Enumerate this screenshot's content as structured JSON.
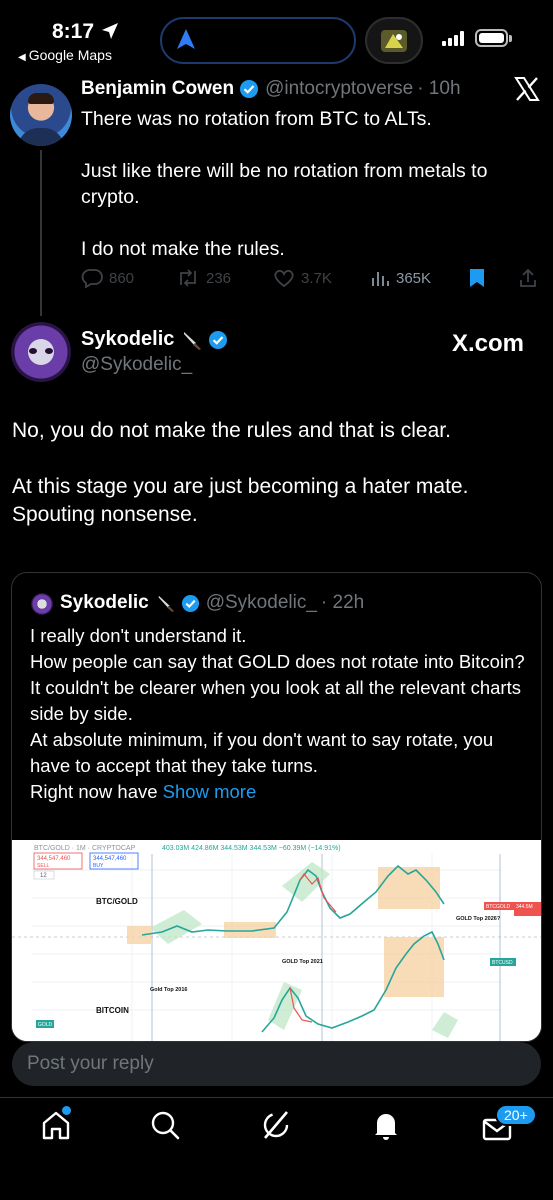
{
  "status_bar": {
    "time": "8:17",
    "back_app": "Google Maps"
  },
  "tweet1": {
    "author_name": "Benjamin Cowen",
    "handle": "@intocryptoverse",
    "time_ago": "· 10h",
    "paragraphs": [
      "There was no rotation from BTC to ALTs.",
      "Just like there will be no rotation from metals to crypto.",
      "I do not make the rules."
    ],
    "replies": "860",
    "reposts": "236",
    "likes": "3.7K",
    "views": "365K"
  },
  "tweet2": {
    "author_name": "Sykodelic",
    "handle": "@Sykodelic_",
    "brand": "X.com",
    "paragraphs": [
      "No, you do not make the rules and that is clear.",
      "At this stage you are just becoming a hater mate. Spouting nonsense."
    ]
  },
  "quote": {
    "author_name": "Sykodelic",
    "handle": "@Sykodelic_",
    "time_ago": "· 22h",
    "lines": [
      "I really don't understand it.",
      "How people can say that GOLD does not rotate into Bitcoin?",
      "It couldn't be clearer when you look at all the relevant charts side by side.",
      "At absolute minimum, if you don't want to say rotate, you have to accept that they take turns."
    ],
    "last_line": "Right now have",
    "show_more": "Show more",
    "chart": {
      "header": "BTC/GOLD · 1M · CRYPTOCAP",
      "header_values": "403.03M  424.86M  344.53M  344.53M  −60.39M (−14.91%)",
      "sell_price": "344,547,460",
      "sell_label": "SELL",
      "buy_price": "344,547,460",
      "buy_label": "BUY",
      "label_btcgold": "BTC/GOLD",
      "label_bitcoin": "BITCOIN",
      "label_gold": "GOLD",
      "ann_gold_2016": "Gold Top 2016",
      "ann_gold_2021": "GOLD Top 2021",
      "ann_gold_2026": "GOLD Top 2026?",
      "tag_btcgold": "BTCGOLD",
      "tag_btcusd": "BTCUSD",
      "tag_price": "344.5M",
      "small_tag": "12"
    }
  },
  "reply_placeholder": "Post your reply",
  "nav": {
    "messages_badge": "20+"
  }
}
